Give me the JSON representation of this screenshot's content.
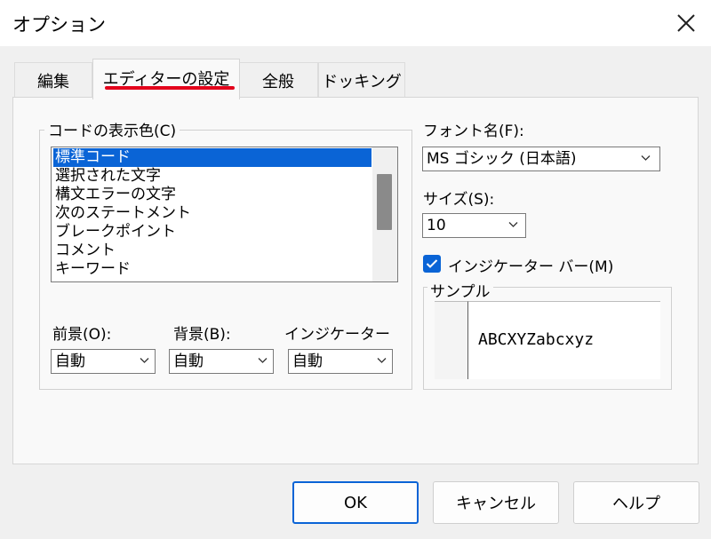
{
  "window": {
    "title": "オプション",
    "close_icon": "close-icon"
  },
  "tabs": [
    {
      "label": "編集"
    },
    {
      "label": "エディターの設定"
    },
    {
      "label": "全般"
    },
    {
      "label": "ドッキング"
    }
  ],
  "active_tab": "エディターの設定",
  "code_colors": {
    "group_label": "コードの表示色(C)",
    "items": [
      "標準コード",
      "選択された文字",
      "構文エラーの文字",
      "次のステートメント",
      "ブレークポイント",
      "コメント",
      "キーワード"
    ],
    "selected": "標準コード"
  },
  "color_pickers": {
    "foreground": {
      "label": "前景(O):",
      "value": "自動"
    },
    "background": {
      "label": "背景(B):",
      "value": "自動"
    },
    "indicator": {
      "label": "インジケーター",
      "value": "自動"
    }
  },
  "font": {
    "label": "フォント名(F):",
    "value": "MS ゴシック (日本語)"
  },
  "size": {
    "label": "サイズ(S):",
    "value": "10"
  },
  "indicator_bar": {
    "label": "インジケーター バー(M)",
    "checked": true
  },
  "sample": {
    "label": "サンプル",
    "text": "ABCXYZabcxyz"
  },
  "buttons": {
    "ok": "OK",
    "cancel": "キャンセル",
    "help": "ヘルプ"
  },
  "colors": {
    "accent": "#0a64d6",
    "tab_underline": "#e3001b"
  }
}
